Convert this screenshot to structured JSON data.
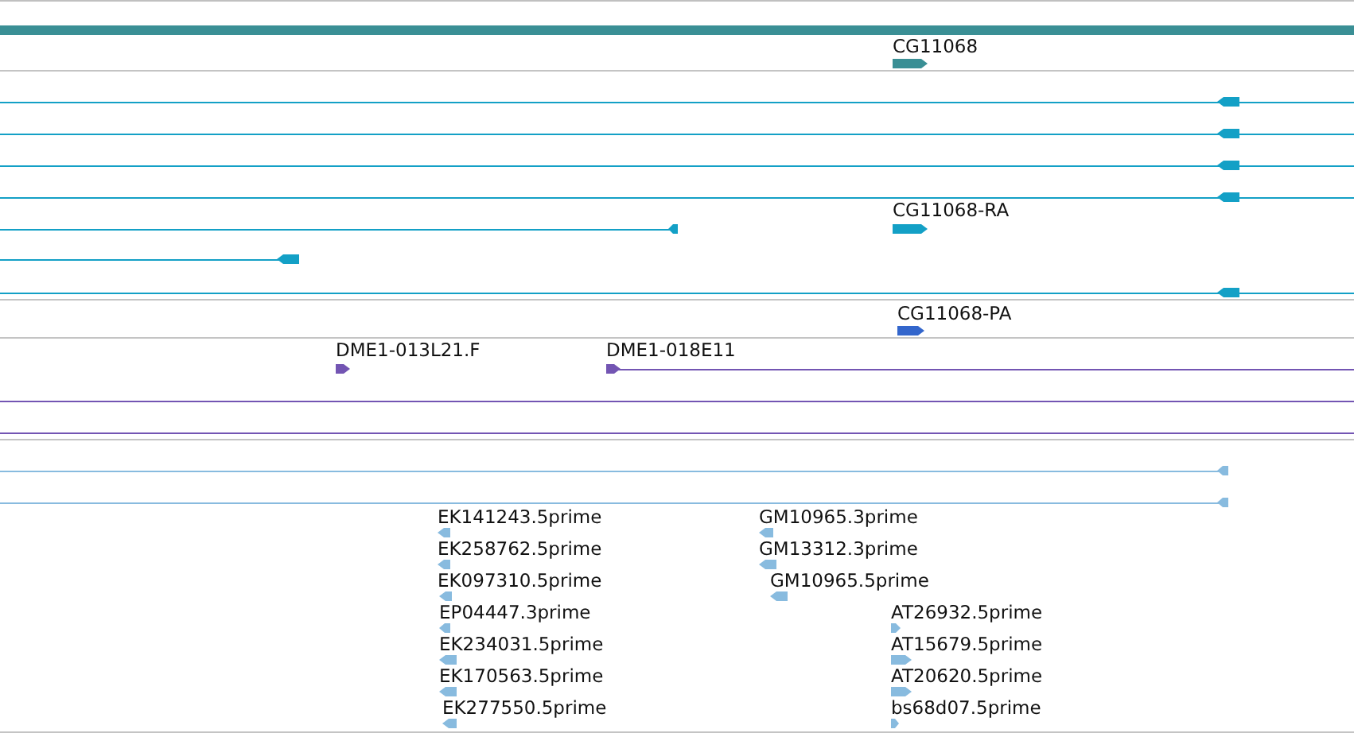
{
  "tracks": [
    {
      "kind": "gene",
      "color": "#3a8f95",
      "features": [
        {
          "kind": "arrow",
          "label": "CG11068",
          "reverse": false
        }
      ]
    },
    {
      "kind": "transcript",
      "color": "#13a0c6",
      "features": [
        {
          "kind": "arrow",
          "reverse": true
        },
        {
          "kind": "arrow",
          "reverse": true
        },
        {
          "kind": "arrow",
          "reverse": true
        },
        {
          "kind": "arrow",
          "reverse": true
        },
        {
          "kind": "arrow",
          "reverse": true
        },
        {
          "kind": "arrow",
          "label": "CG11068-RA",
          "reverse": false
        },
        {
          "kind": "arrow",
          "reverse": true
        },
        {
          "kind": "arrow",
          "reverse": true
        }
      ]
    },
    {
      "kind": "transcript",
      "color": "#3366cc",
      "features": [
        {
          "kind": "arrow",
          "label": "CG11068-PA",
          "reverse": false
        }
      ]
    },
    {
      "kind": "clone",
      "color": "#7355b3",
      "features": [
        {
          "kind": "arrow",
          "label": "DME1-013L21.F",
          "reverse": false
        },
        {
          "kind": "arrow",
          "label": "DME1-018E11",
          "reverse": false
        },
        {
          "kind": "line"
        },
        {
          "kind": "line"
        }
      ]
    },
    {
      "kind": "est",
      "color": "#88bbdf",
      "features": [
        {
          "kind": "arrow",
          "reverse": true
        },
        {
          "kind": "arrow",
          "reverse": true
        },
        {
          "kind": "arrow",
          "label": "EK141243.5prime",
          "reverse": true
        },
        {
          "kind": "arrow",
          "label": "EK258762.5prime",
          "reverse": true
        },
        {
          "kind": "arrow",
          "label": "EK097310.5prime",
          "reverse": true
        },
        {
          "kind": "arrow",
          "label": "EP04447.3prime",
          "reverse": true
        },
        {
          "kind": "arrow",
          "label": "EK234031.5prime",
          "reverse": true
        },
        {
          "kind": "arrow",
          "label": "EK170563.5prime",
          "reverse": true
        },
        {
          "kind": "arrow",
          "label": "EK277550.5prime",
          "reverse": true
        },
        {
          "kind": "arrow",
          "label": "GM10965.3prime",
          "reverse": true
        },
        {
          "kind": "arrow",
          "label": "GM13312.3prime",
          "reverse": true
        },
        {
          "kind": "arrow",
          "label": "GM10965.5prime",
          "reverse": true
        },
        {
          "kind": "arrow",
          "label": "AT26932.5prime",
          "reverse": false
        },
        {
          "kind": "arrow",
          "label": "AT15679.5prime",
          "reverse": false
        },
        {
          "kind": "arrow",
          "label": "AT20620.5prime",
          "reverse": false
        },
        {
          "kind": "arrow",
          "label": "bs68d07.5prime",
          "reverse": false
        }
      ]
    }
  ]
}
